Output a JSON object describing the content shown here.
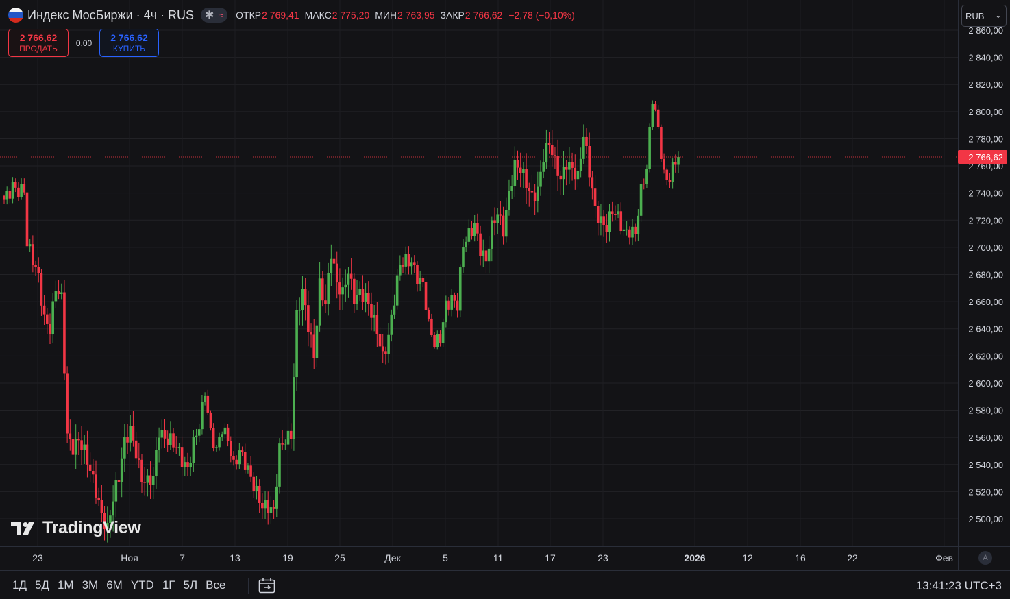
{
  "header": {
    "symbol": "Индекс МосБиржи · 4ч · RUS",
    "status_icon_1": "asterisk-icon",
    "status_icon_2": "wave-icon",
    "ohlc": {
      "open_label": "ОТКР",
      "open_value": "2 769,41",
      "high_label": "МАКС",
      "high_value": "2 775,20",
      "low_label": "МИН",
      "low_value": "2 763,95",
      "close_label": "ЗАКР",
      "close_value": "2 766,62",
      "change": "−2,78 (−0,10%)"
    }
  },
  "trade": {
    "sell_price": "2 766,62",
    "sell_label": "ПРОДАТЬ",
    "spread": "0,00",
    "buy_price": "2 766,62",
    "buy_label": "КУПИТЬ"
  },
  "currency": {
    "value": "RUB"
  },
  "bottom": {
    "ranges": [
      "1Д",
      "5Д",
      "1М",
      "3М",
      "6М",
      "YTD",
      "1Г",
      "5Л",
      "Все"
    ],
    "clock": "13:41:23 UTC+3",
    "auto_label": "A"
  },
  "logo": {
    "text": "TradingView"
  },
  "colors": {
    "background": "#131316",
    "up": "#4caf50",
    "down": "#f23645",
    "grid": "#232327",
    "text": "#d1d4dc",
    "buy": "#2962ff"
  },
  "chart_data": {
    "type": "candlestick",
    "interval": "4ч",
    "y_ticks": [
      "2 500,00",
      "2 520,00",
      "2 540,00",
      "2 560,00",
      "2 580,00",
      "2 600,00",
      "2 620,00",
      "2 640,00",
      "2 660,00",
      "2 680,00",
      "2 700,00",
      "2 720,00",
      "2 740,00",
      "2 760,00",
      "2 780,00",
      "2 800,00",
      "2 820,00",
      "2 840,00",
      "2 860,00"
    ],
    "y_tick_values": [
      2500,
      2520,
      2540,
      2560,
      2580,
      2600,
      2620,
      2640,
      2660,
      2680,
      2700,
      2720,
      2740,
      2760,
      2780,
      2800,
      2820,
      2840,
      2860
    ],
    "ylim": [
      2482,
      2867
    ],
    "x_labels": [
      "23",
      "Ноя",
      "7",
      "13",
      "19",
      "25",
      "Дек",
      "5",
      "11",
      "17",
      "23",
      "2026",
      "12",
      "16",
      "22",
      "Фев"
    ],
    "x_label_bold": "2026",
    "last_price": 2766.62,
    "last_price_label": "2 766,62",
    "grid": true,
    "close_path": [
      [
        0,
        2735
      ],
      [
        3,
        2748
      ],
      [
        5,
        2742
      ],
      [
        7,
        2740
      ],
      [
        8,
        2700
      ],
      [
        10,
        2690
      ],
      [
        12,
        2680
      ],
      [
        14,
        2650
      ],
      [
        16,
        2640
      ],
      [
        18,
        2668
      ],
      [
        20,
        2660
      ],
      [
        22,
        2562
      ],
      [
        24,
        2555
      ],
      [
        26,
        2560
      ],
      [
        28,
        2548
      ],
      [
        30,
        2533
      ],
      [
        32,
        2520
      ],
      [
        34,
        2505
      ],
      [
        36,
        2495
      ],
      [
        38,
        2515
      ],
      [
        40,
        2528
      ],
      [
        42,
        2555
      ],
      [
        44,
        2567
      ],
      [
        46,
        2552
      ],
      [
        48,
        2530
      ],
      [
        50,
        2525
      ],
      [
        52,
        2528
      ],
      [
        54,
        2565
      ],
      [
        56,
        2562
      ],
      [
        58,
        2560
      ],
      [
        60,
        2552
      ],
      [
        62,
        2540
      ],
      [
        64,
        2535
      ],
      [
        66,
        2558
      ],
      [
        68,
        2572
      ],
      [
        70,
        2594
      ],
      [
        72,
        2560
      ],
      [
        74,
        2548
      ],
      [
        76,
        2568
      ],
      [
        78,
        2562
      ],
      [
        80,
        2540
      ],
      [
        82,
        2548
      ],
      [
        84,
        2538
      ],
      [
        86,
        2530
      ],
      [
        88,
        2522
      ],
      [
        90,
        2512
      ],
      [
        92,
        2508
      ],
      [
        94,
        2502
      ],
      [
        96,
        2550
      ],
      [
        98,
        2560
      ],
      [
        100,
        2565
      ],
      [
        102,
        2650
      ],
      [
        104,
        2665
      ],
      [
        106,
        2640
      ],
      [
        108,
        2620
      ],
      [
        110,
        2675
      ],
      [
        112,
        2660
      ],
      [
        114,
        2695
      ],
      [
        116,
        2670
      ],
      [
        118,
        2665
      ],
      [
        120,
        2685
      ],
      [
        122,
        2665
      ],
      [
        124,
        2666
      ],
      [
        126,
        2660
      ],
      [
        128,
        2650
      ],
      [
        130,
        2640
      ],
      [
        132,
        2622
      ],
      [
        134,
        2635
      ],
      [
        136,
        2660
      ],
      [
        138,
        2685
      ],
      [
        140,
        2690
      ],
      [
        142,
        2692
      ],
      [
        144,
        2680
      ],
      [
        146,
        2672
      ],
      [
        148,
        2640
      ],
      [
        150,
        2628
      ],
      [
        152,
        2635
      ],
      [
        154,
        2660
      ],
      [
        156,
        2662
      ],
      [
        158,
        2655
      ],
      [
        160,
        2700
      ],
      [
        162,
        2710
      ],
      [
        164,
        2720
      ],
      [
        166,
        2700
      ],
      [
        168,
        2688
      ],
      [
        170,
        2712
      ],
      [
        172,
        2725
      ],
      [
        174,
        2715
      ],
      [
        176,
        2742
      ],
      [
        178,
        2760
      ],
      [
        180,
        2755
      ],
      [
        182,
        2745
      ],
      [
        184,
        2738
      ],
      [
        186,
        2745
      ],
      [
        188,
        2768
      ],
      [
        190,
        2775
      ],
      [
        192,
        2760
      ],
      [
        194,
        2750
      ],
      [
        196,
        2765
      ],
      [
        198,
        2760
      ],
      [
        200,
        2750
      ],
      [
        202,
        2780
      ],
      [
        204,
        2755
      ],
      [
        206,
        2730
      ],
      [
        208,
        2722
      ],
      [
        210,
        2715
      ],
      [
        212,
        2725
      ],
      [
        214,
        2720
      ],
      [
        216,
        2712
      ],
      [
        218,
        2715
      ],
      [
        220,
        2712
      ],
      [
        222,
        2740
      ],
      [
        224,
        2755
      ],
      [
        226,
        2810
      ],
      [
        228,
        2790
      ],
      [
        230,
        2755
      ],
      [
        232,
        2750
      ],
      [
        234,
        2762
      ],
      [
        235,
        2767
      ]
    ]
  }
}
